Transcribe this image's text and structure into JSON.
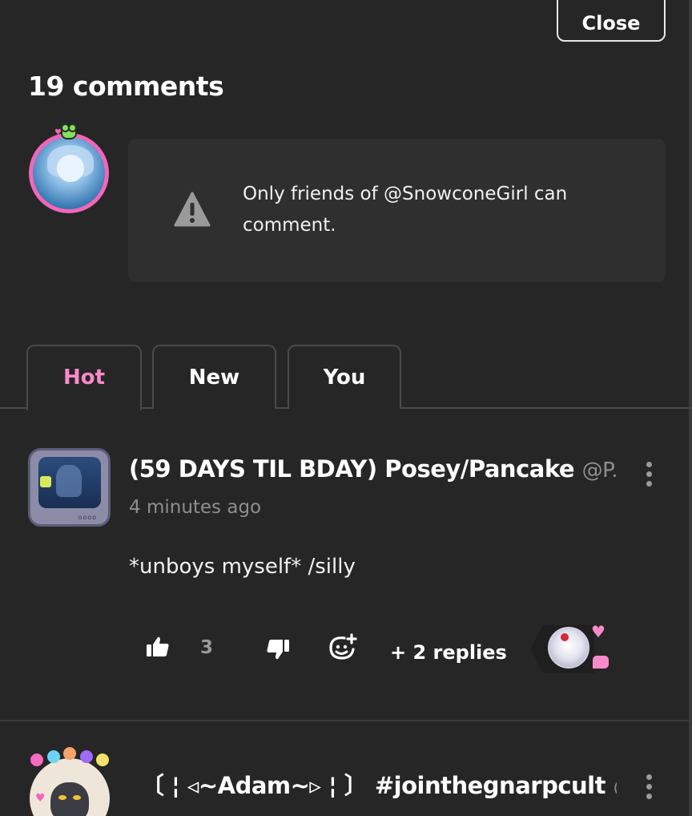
{
  "header": {
    "close_label": "Close",
    "comment_count_label": "19 comments"
  },
  "notice": {
    "text": "Only friends of @SnowconeGirl can comment.",
    "icon": "warning-icon"
  },
  "tabs": [
    {
      "label": "Hot",
      "active": true
    },
    {
      "label": "New",
      "active": false
    },
    {
      "label": "You",
      "active": false
    }
  ],
  "comments": [
    {
      "display_name": "(59 DAYS TIL BDAY) Posey/Pancake",
      "handle": "@P...",
      "time": "4 minutes ago",
      "body": "*unboys myself* /silly",
      "likes": "3",
      "replies_label": "+ 2 replies"
    },
    {
      "display_name": "〔 ¦ ◃~Adam~▹ ¦ 〕 #jointhegnarpcult",
      "handle": "@..."
    }
  ],
  "colors": {
    "background": "#262626",
    "accent_pink": "#f98ac9",
    "muted_text": "#8e8e8e",
    "notice_bg": "#2f2f2f"
  }
}
